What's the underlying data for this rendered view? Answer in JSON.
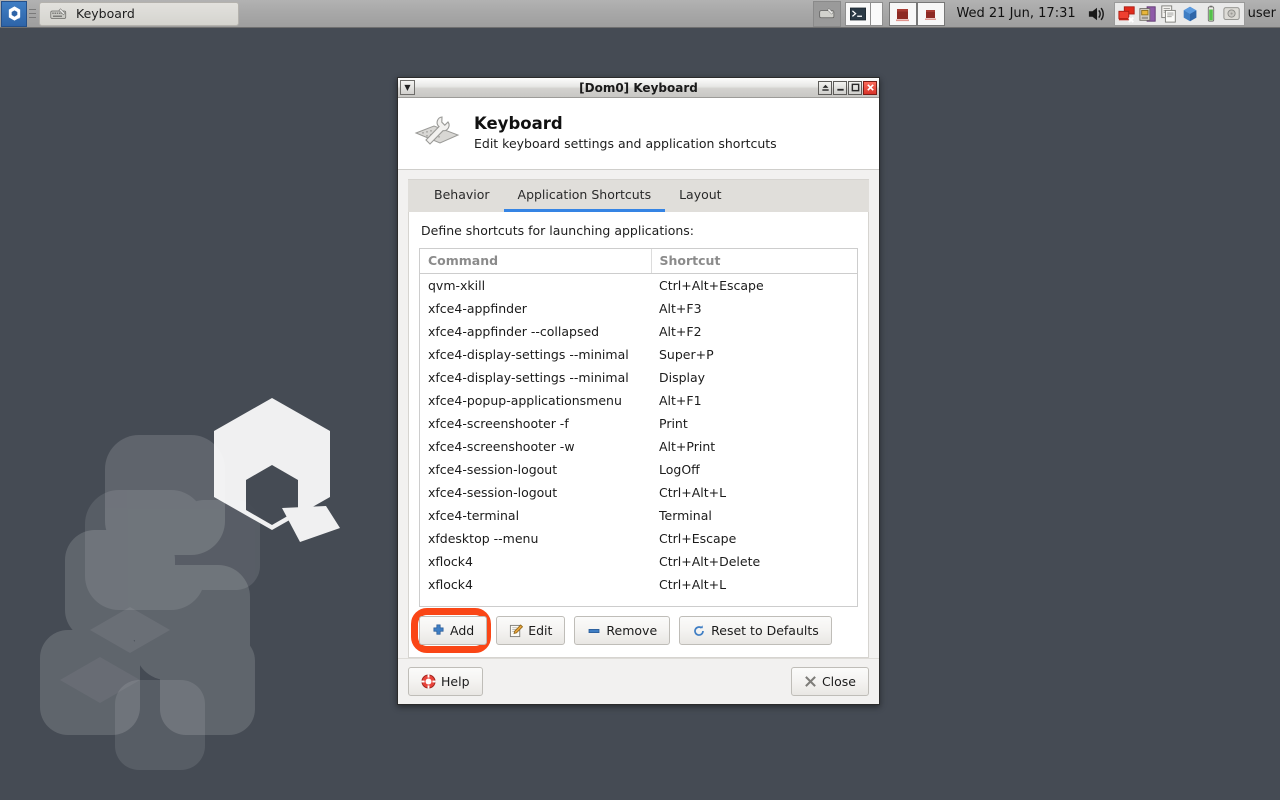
{
  "taskbar": {
    "qubes_menu_icon": "qubes-logo-icon",
    "window_button": {
      "icon": "keyboard-icon",
      "label": "Keyboard"
    },
    "pager_icon": "keyboard-icon",
    "terminal_icon": "terminal-icon",
    "workspace_switcher": [
      "workspace-1",
      "workspace-2"
    ],
    "clock": "Wed 21 Jun, 17:31",
    "volume_icon": "speaker-icon",
    "tray_icons": [
      "qubes-devices-icon",
      "qubes-disk-icon",
      "qubes-clipboard-icon",
      "qubes-updates-icon",
      "battery-icon",
      "qubes-storage-icon"
    ],
    "user_label": "user"
  },
  "window": {
    "title": "[Dom0] Keyboard",
    "menu_button_glyph": "▼",
    "buttons": {
      "shade": "shade-button",
      "minimize": "minimize-button",
      "maximize": "maximize-button",
      "close": "close-button"
    }
  },
  "header": {
    "icon": "keyboard-settings-icon",
    "title": "Keyboard",
    "subtitle": "Edit keyboard settings and application shortcuts"
  },
  "tabs": [
    {
      "id": "behavior",
      "label": "Behavior",
      "active": false
    },
    {
      "id": "application-shortcuts",
      "label": "Application Shortcuts",
      "active": true
    },
    {
      "id": "layout",
      "label": "Layout",
      "active": false
    }
  ],
  "content": {
    "define_label": "Define shortcuts for launching applications:",
    "columns": [
      "Command",
      "Shortcut"
    ],
    "rows": [
      {
        "command": "qvm-xkill",
        "shortcut": "Ctrl+Alt+Escape"
      },
      {
        "command": "xfce4-appfinder",
        "shortcut": "Alt+F3"
      },
      {
        "command": "xfce4-appfinder --collapsed",
        "shortcut": "Alt+F2"
      },
      {
        "command": "xfce4-display-settings --minimal",
        "shortcut": "Super+P"
      },
      {
        "command": "xfce4-display-settings --minimal",
        "shortcut": "Display"
      },
      {
        "command": "xfce4-popup-applicationsmenu",
        "shortcut": "Alt+F1"
      },
      {
        "command": "xfce4-screenshooter -f",
        "shortcut": "Print"
      },
      {
        "command": "xfce4-screenshooter -w",
        "shortcut": "Alt+Print"
      },
      {
        "command": "xfce4-session-logout",
        "shortcut": "LogOff"
      },
      {
        "command": "xfce4-session-logout",
        "shortcut": "Ctrl+Alt+L"
      },
      {
        "command": "xfce4-terminal",
        "shortcut": "Terminal"
      },
      {
        "command": "xfdesktop --menu",
        "shortcut": "Ctrl+Escape"
      },
      {
        "command": "xflock4",
        "shortcut": "Ctrl+Alt+Delete"
      },
      {
        "command": "xflock4",
        "shortcut": "Ctrl+Alt+L"
      }
    ]
  },
  "actions": {
    "add": {
      "label": "Add",
      "icon": "plus-icon",
      "highlighted": true
    },
    "edit": {
      "label": "Edit",
      "icon": "pencil-icon"
    },
    "remove": {
      "label": "Remove",
      "icon": "minus-icon"
    },
    "reset": {
      "label": "Reset to Defaults",
      "icon": "refresh-icon"
    }
  },
  "footer": {
    "help": {
      "label": "Help",
      "icon": "lifebuoy-icon"
    },
    "close": {
      "label": "Close",
      "icon": "cross-icon"
    }
  },
  "colors": {
    "desktop_bg": "#454b54",
    "accent_tab": "#3584e4",
    "highlight_ring": "#fa4616",
    "close_button": "#d9342a"
  }
}
